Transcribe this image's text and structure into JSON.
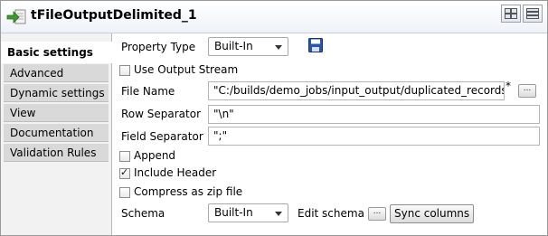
{
  "component": {
    "title": "tFileOutputDelimited_1"
  },
  "tabs": [
    {
      "label": "Basic settings",
      "active": true
    },
    {
      "label": "Advanced settings"
    },
    {
      "label": "Dynamic settings"
    },
    {
      "label": "View"
    },
    {
      "label": "Documentation"
    },
    {
      "label": "Validation Rules"
    }
  ],
  "form": {
    "property_type": {
      "label": "Property Type",
      "value": "Built-In"
    },
    "use_output_stream": {
      "label": "Use Output Stream",
      "checked": false
    },
    "file_name": {
      "label": "File Name",
      "value": "\"C:/builds/demo_jobs/input_output/duplicated_records.csv\"",
      "required_marker": "*",
      "browse_label": "..."
    },
    "row_separator": {
      "label": "Row Separator",
      "value": "\"\\n\""
    },
    "field_separator": {
      "label": "Field Separator",
      "value": "\";\""
    },
    "append": {
      "label": "Append",
      "checked": false
    },
    "include_header": {
      "label": "Include Header",
      "checked": true
    },
    "compress_zip": {
      "label": "Compress as zip file",
      "checked": false
    },
    "schema": {
      "label": "Schema",
      "value": "Built-In",
      "edit_label": "Edit schema",
      "edit_button": "...",
      "sync_label": "Sync columns"
    }
  },
  "icons": {
    "component": "file-output-arrow-icon",
    "save": "save-disk-icon",
    "view_toggle_1": "layout-grid-icon",
    "view_toggle_2": "layout-list-icon"
  },
  "colors": {
    "sidebar_tab": "#d9d9d9",
    "active_tab": "#ffffff",
    "icon_green": "#3a9a2a",
    "save_blue": "#2a55a8"
  }
}
